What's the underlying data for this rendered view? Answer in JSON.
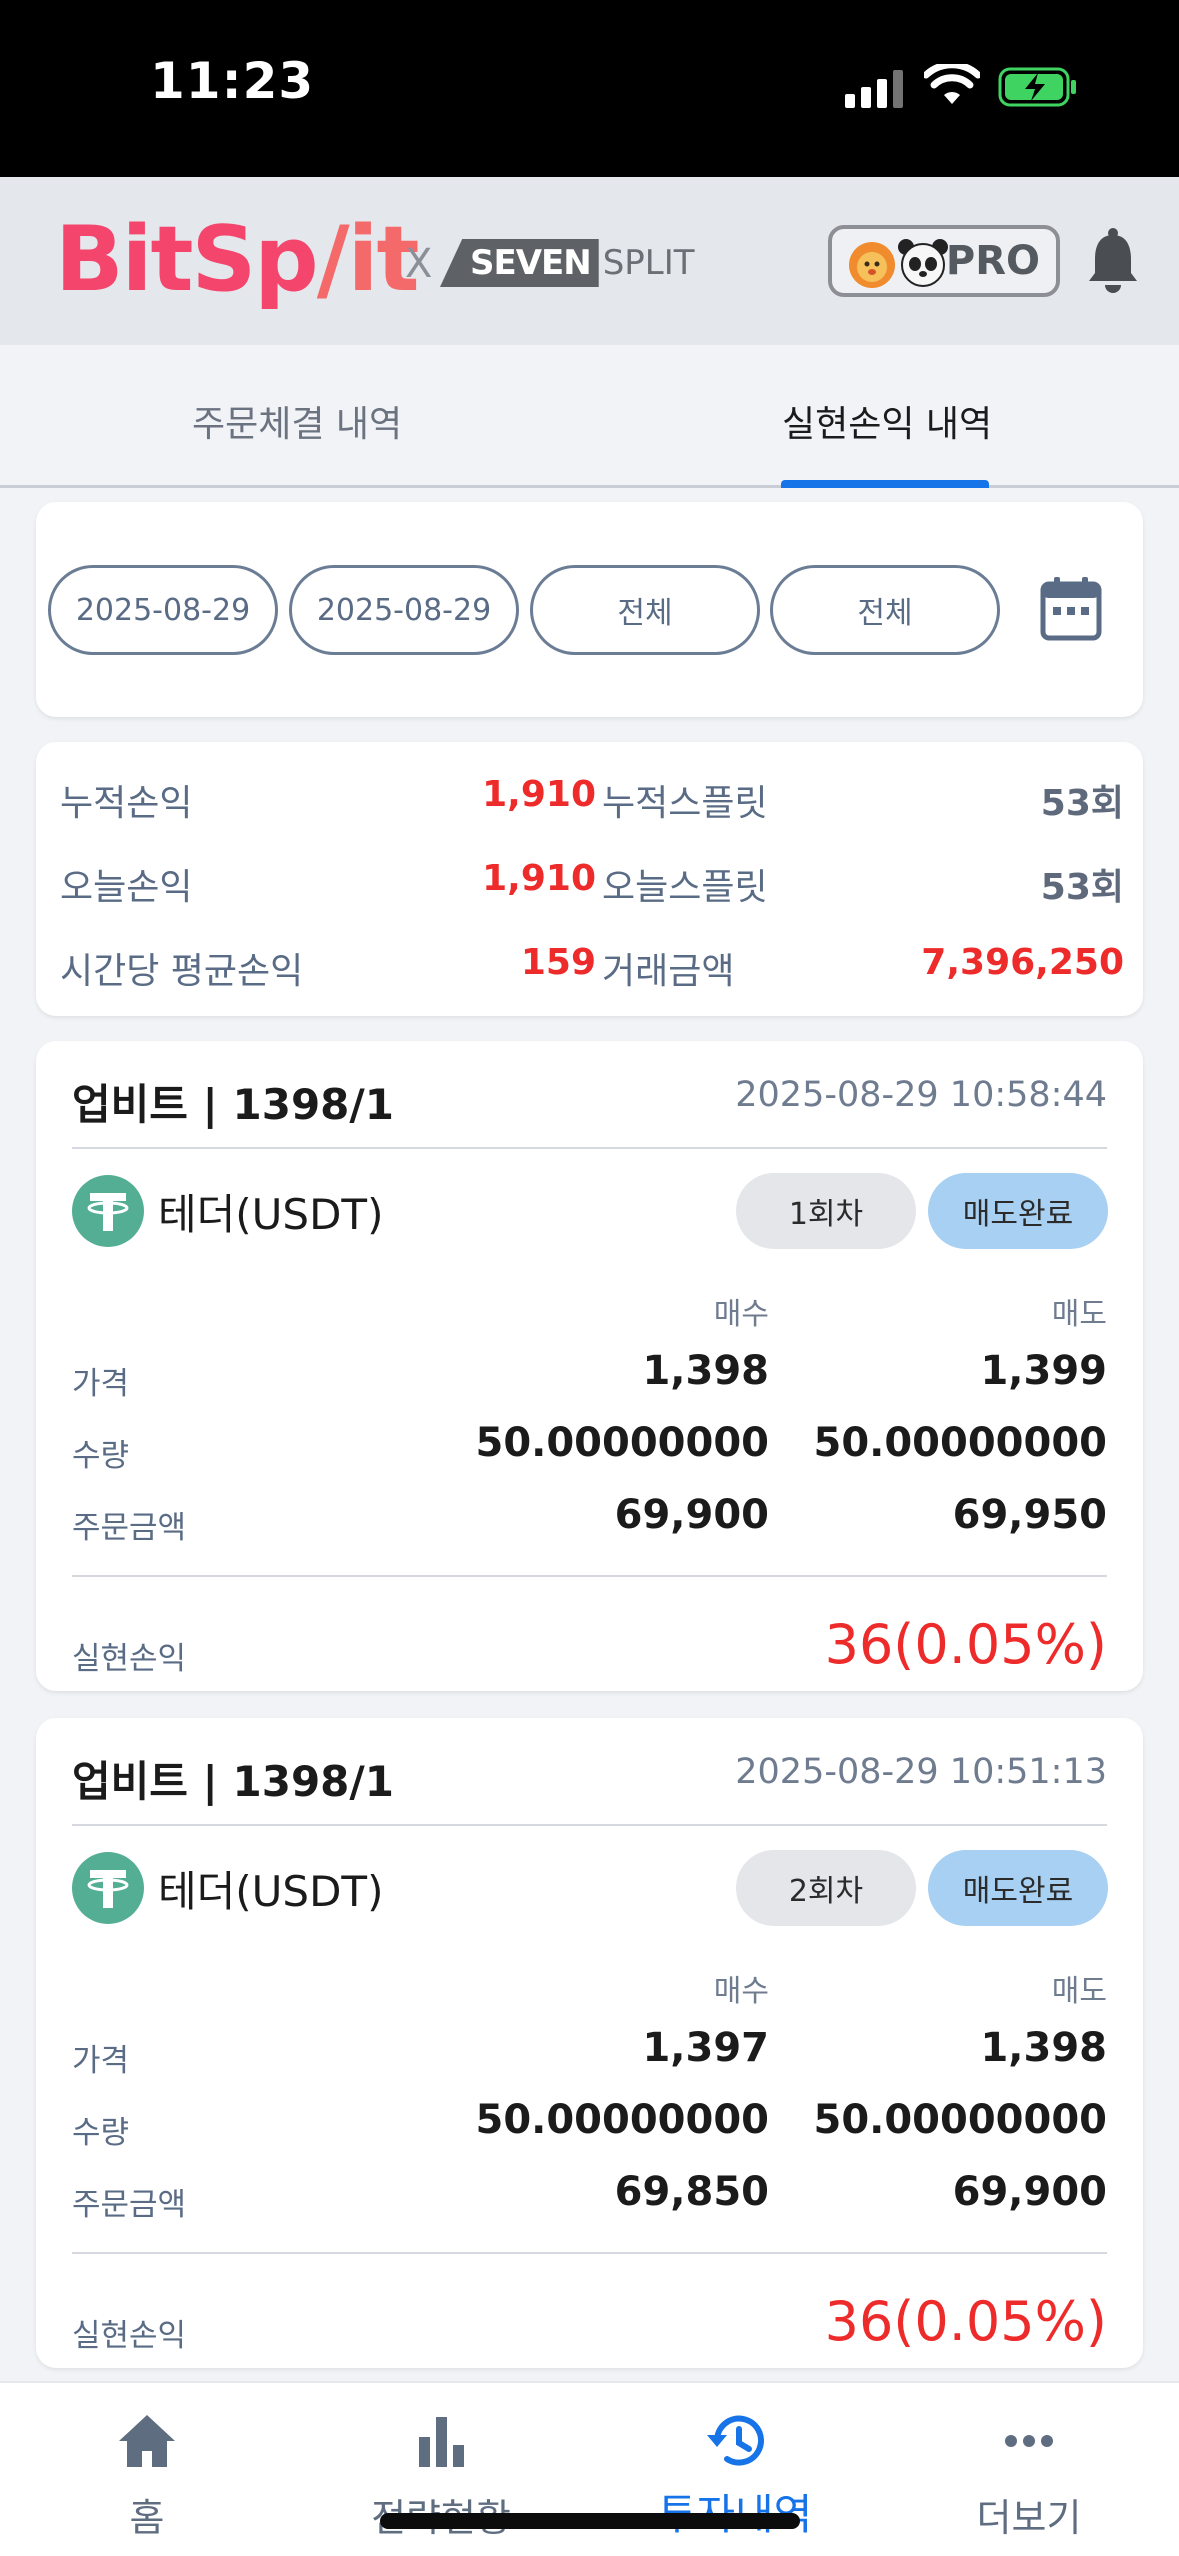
{
  "status_bar": {
    "time": "11:23"
  },
  "header": {
    "logo_bit": "BitSp",
    "logo_split": "/it",
    "partner_x": "X",
    "partner_seven": "SEVEN",
    "partner_split": "SPLIT",
    "pro_label": "PRO"
  },
  "tabs": [
    {
      "label": "주문체결 내역",
      "active": false
    },
    {
      "label": "실현손익 내역",
      "active": true
    }
  ],
  "filters": {
    "start_date": "2025-08-29",
    "end_date": "2025-08-29",
    "filter_1": "전체",
    "filter_2": "전체"
  },
  "summary": {
    "cum_pl_label": "누적손익",
    "cum_pl_value": "1,910",
    "cum_split_label": "누적스플릿",
    "cum_split_value": "53회",
    "today_pl_label": "오늘손익",
    "today_pl_value": "1,910",
    "today_split_label": "오늘스플릿",
    "today_split_value": "53회",
    "hourly_label": "시간당 평균손익",
    "hourly_value": "159",
    "volume_label": "거래금액",
    "volume_value": "7,396,250"
  },
  "trades": [
    {
      "exchange": "업비트 | 1398/1",
      "datetime": "2025-08-29 10:58:44",
      "coin": "테더(USDT)",
      "round": "1회차",
      "status": "매도완료",
      "buy_header": "매수",
      "sell_header": "매도",
      "price_label": "가격",
      "buy_price": "1,398",
      "sell_price": "1,399",
      "qty_label": "수량",
      "buy_qty": "50.00000000",
      "sell_qty": "50.00000000",
      "amount_label": "주문금액",
      "buy_amount": "69,900",
      "sell_amount": "69,950",
      "pl_label": "실현손익",
      "pl_value": "36(0.05%)"
    },
    {
      "exchange": "업비트 | 1398/1",
      "datetime": "2025-08-29 10:51:13",
      "coin": "테더(USDT)",
      "round": "2회차",
      "status": "매도완료",
      "buy_header": "매수",
      "sell_header": "매도",
      "price_label": "가격",
      "buy_price": "1,397",
      "sell_price": "1,398",
      "qty_label": "수량",
      "buy_qty": "50.00000000",
      "sell_qty": "50.00000000",
      "amount_label": "주문금액",
      "buy_amount": "69,850",
      "sell_amount": "69,900",
      "pl_label": "실현손익",
      "pl_value": "36(0.05%)"
    }
  ],
  "bottom_nav": [
    {
      "label": "홈",
      "icon": "home-icon"
    },
    {
      "label": "전략현황",
      "icon": "bar-chart-icon"
    },
    {
      "label": "투자내역",
      "icon": "history-icon",
      "active": true
    },
    {
      "label": "더보기",
      "icon": "more-icon"
    }
  ],
  "colors": {
    "accent": "#1773e8",
    "profit_red": "#ee2b2b",
    "status_badge": "#a7d0f2"
  }
}
